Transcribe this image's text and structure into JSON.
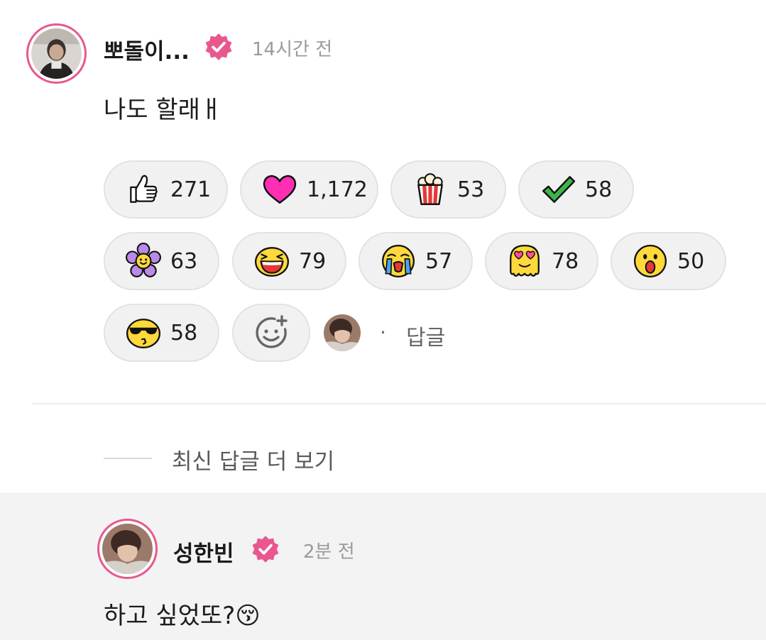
{
  "comment": {
    "author": "뽀돌이...",
    "time": "14시간 전",
    "text": "나도 할래ㅐ",
    "reactions": [
      {
        "icon": "thumbs-up",
        "count": "271"
      },
      {
        "icon": "heart",
        "count": "1,172"
      },
      {
        "icon": "popcorn",
        "count": "53"
      },
      {
        "icon": "check",
        "count": "58"
      },
      {
        "icon": "flower",
        "count": "63"
      },
      {
        "icon": "laughing-face",
        "count": "79"
      },
      {
        "icon": "crying-face",
        "count": "57"
      },
      {
        "icon": "heart-eyes-melting-face",
        "count": "78"
      },
      {
        "icon": "surprised-face",
        "count": "50"
      },
      {
        "icon": "sunglasses-kiss-face",
        "count": "58"
      }
    ],
    "reply_dot": "·",
    "reply_label": "답글"
  },
  "more_replies_label": "최신 답글 더 보기",
  "reply": {
    "author": "성한빈",
    "time": "2분 전",
    "text": "하고 싶었또?😚"
  },
  "colors": {
    "accent": "#e8588f",
    "pill_bg": "#f1f1f1",
    "reply_bg": "#f3f3f3"
  }
}
